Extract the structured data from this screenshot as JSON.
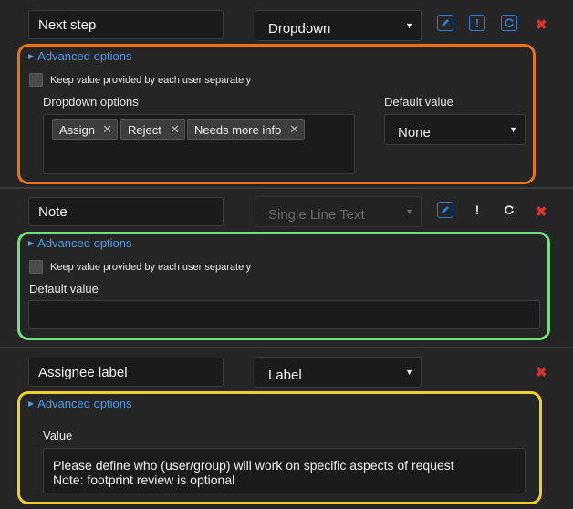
{
  "fields": [
    {
      "name": "Next step",
      "type": "Dropdown",
      "advanced": {
        "link": "Advanced options",
        "keep_value": "Keep value provided by each user separately",
        "options_label": "Dropdown options",
        "options": [
          "Assign",
          "Reject",
          "Needs more info"
        ],
        "default_label": "Default value",
        "default_value": "None"
      },
      "border_color": "#e8731c"
    },
    {
      "name": "Note",
      "type": "Single Line Text",
      "advanced": {
        "link": "Advanced options",
        "keep_value": "Keep value provided by each user separately",
        "default_label": "Default value",
        "default_value": ""
      },
      "border_color": "#6ee07e"
    },
    {
      "name": "Assignee label",
      "type": "Label",
      "advanced": {
        "link": "Advanced options",
        "value_label": "Value",
        "value_line1": "Please define who (user/group) will work on specific aspects of request",
        "value_line2": "Note: footprint review is optional"
      },
      "border_color": "#f1cf2b"
    }
  ],
  "icons": {
    "edit": "pencil-icon",
    "required": "exclamation-icon",
    "refresh": "refresh-icon",
    "delete": "close-icon"
  },
  "colors": {
    "link": "#4d9bea",
    "icon_blue": "#2f7bd6",
    "delete_red": "#d8322c"
  }
}
